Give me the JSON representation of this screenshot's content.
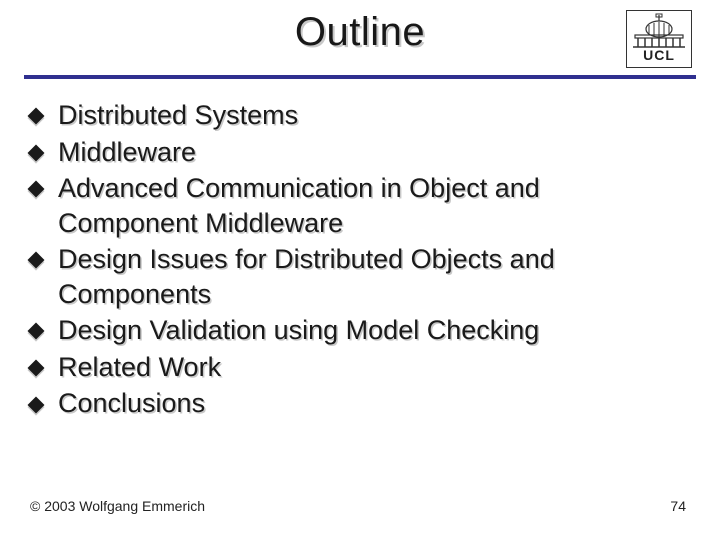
{
  "title": "Outline",
  "logo": {
    "text": "UCL"
  },
  "bullets": [
    "Distributed Systems",
    "Middleware",
    "Advanced Communication in Object and Component Middleware",
    "Design Issues for Distributed Objects and Components",
    "Design Validation using Model Checking",
    "Related Work",
    "Conclusions"
  ],
  "footer": {
    "copyright": "© 2003 Wolfgang Emmerich",
    "page": "74"
  }
}
